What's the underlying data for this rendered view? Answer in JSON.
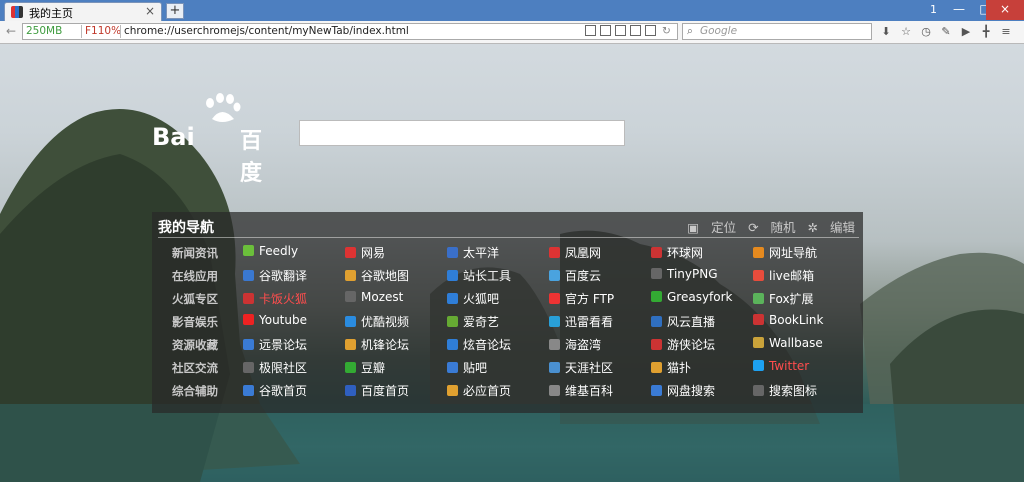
{
  "tab": {
    "title": "我的主页",
    "close": "×"
  },
  "new_tab": "+",
  "tab_count": "1",
  "window": {
    "minimize": "—",
    "restore": "□",
    "close": "×"
  },
  "nav": {
    "back": "←",
    "memory": "250MB",
    "zoom": "F110%",
    "url": "chrome://userchromejs/content/myNewTab/index.html",
    "search_placeholder": "Google"
  },
  "page": {
    "logo_text": "Bai",
    "logo_cn": "百度",
    "panel_title": "我的导航",
    "actions": [
      "定位",
      "随机",
      "编辑"
    ],
    "categories": [
      "新闻资讯",
      "在线应用",
      "火狐专区",
      "影音娱乐",
      "资源收藏",
      "社区交流",
      "综合辅助"
    ],
    "rows": [
      [
        "Feedly",
        "网易",
        "太平洋",
        "凤凰网",
        "环球网",
        "网址导航"
      ],
      [
        "谷歌翻译",
        "谷歌地图",
        "站长工具",
        "百度云",
        "TinyPNG",
        "live邮箱"
      ],
      [
        "卡饭火狐",
        "Mozest",
        "火狐吧",
        "官方 FTP",
        "Greasyfork",
        "Fox扩展"
      ],
      [
        "Youtube",
        "优酷视频",
        "爱奇艺",
        "迅雷看看",
        "风云直播",
        "BookLink"
      ],
      [
        "远景论坛",
        "机锋论坛",
        "炫音论坛",
        "海盗湾",
        "游侠论坛",
        "Wallbase"
      ],
      [
        "极限社区",
        "豆瓣",
        "贴吧",
        "天涯社区",
        "猫扑",
        "Twitter"
      ],
      [
        "谷歌首页",
        "百度首页",
        "必应首页",
        "维基百科",
        "网盘搜索",
        "搜索图标"
      ]
    ],
    "icon_colors": [
      [
        "#6bbf3b",
        "#d33",
        "#3a6fc9",
        "#d33",
        "#c33",
        "#e58a1f"
      ],
      [
        "#3a78d0",
        "#e0a030",
        "#2f7ed8",
        "#4aa3df",
        "#666",
        "#e74c3c"
      ],
      [
        "#c33",
        "#666",
        "#2f7ed8",
        "#e33",
        "#3a3",
        "#5bb35b"
      ],
      [
        "#e22",
        "#2a8ce0",
        "#6a3",
        "#29a0d8",
        "#2f6fc0",
        "#c33"
      ],
      [
        "#3a7bd5",
        "#e0a030",
        "#2f7ed8",
        "#888",
        "#c33",
        "#caa33a"
      ],
      [
        "#666",
        "#3a3",
        "#3a7bd5",
        "#4a90d0",
        "#e0a030",
        "#1da1f2"
      ],
      [
        "#3a7bd5",
        "#2f5fbf",
        "#e0a030",
        "#888",
        "#3a7bd5",
        "#666"
      ]
    ],
    "link_color_red": [
      "卡饭火狐",
      "Twitter"
    ]
  }
}
